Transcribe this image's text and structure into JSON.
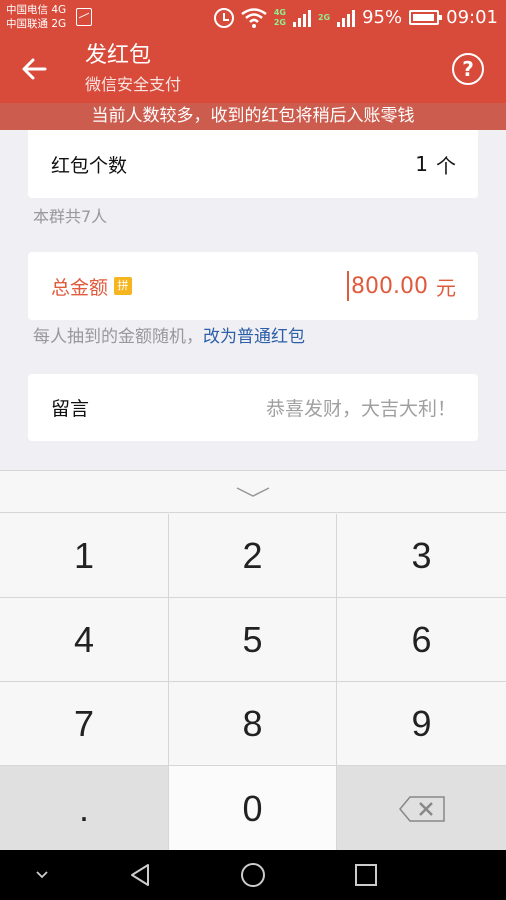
{
  "status_bar": {
    "carrier_line1": "中国电信 4G",
    "carrier_line2": "中国联通 2G",
    "net_top": "4G",
    "net_bottom": "2G",
    "net_type_right": "2G",
    "battery": "95%",
    "time": "09:01"
  },
  "header": {
    "title": "发红包",
    "subtitle": "微信安全支付",
    "help_label": "?"
  },
  "notice": "当前人数较多，收到的红包将稍后入账零钱",
  "packet_count": {
    "label": "红包个数",
    "value": "1",
    "unit": "个",
    "note": "本群共7人"
  },
  "total_amount": {
    "label": "总金额",
    "badge": "拼",
    "value": "800.00",
    "unit": "元",
    "note": "每人抽到的金额随机，",
    "link": "改为普通红包"
  },
  "message": {
    "label": "留言",
    "placeholder": "恭喜发财，大吉大利！"
  },
  "keypad": {
    "keys": [
      "1",
      "2",
      "3",
      "4",
      "5",
      "6",
      "7",
      "8",
      "9",
      ".",
      "0"
    ]
  },
  "colors": {
    "brand_red": "#d84a3a",
    "accent_orange": "#e05a3c",
    "link_blue": "#2d5fa8"
  }
}
